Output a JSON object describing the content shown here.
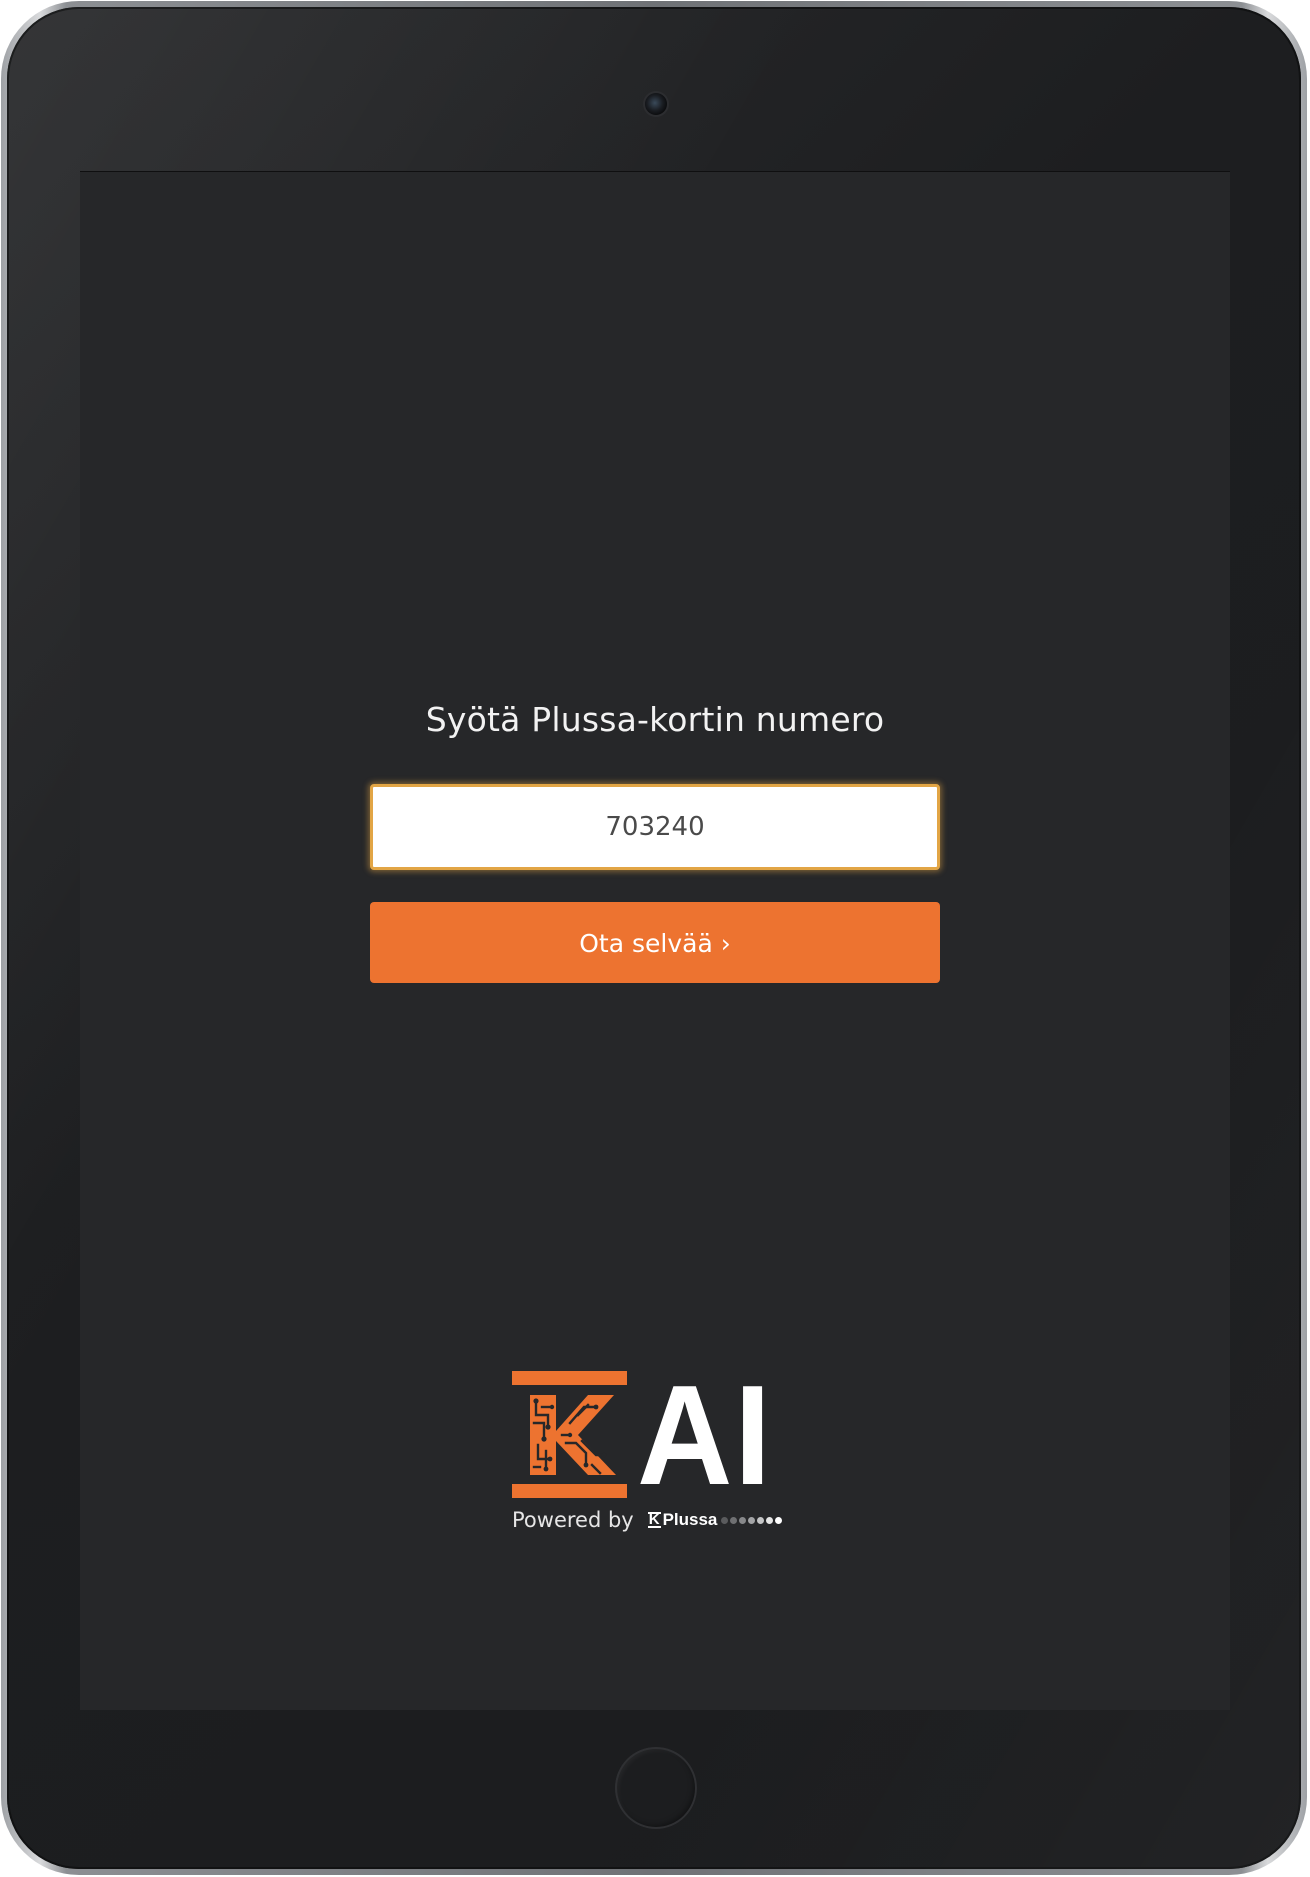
{
  "form": {
    "prompt": "Syötä Plussa-kortin numero",
    "card_number_value": "703240",
    "submit_label": "Ota selvää ›"
  },
  "branding": {
    "logo_text": "AI",
    "powered_by": "Powered by",
    "partner_name": "Plussa",
    "partner_mark": "K"
  },
  "icons": {
    "logo": "k-logo-icon",
    "camera": "camera-icon",
    "home": "home-button-icon"
  },
  "colors": {
    "accent": "#ed7330",
    "screen_background": "#262729",
    "input_focus_border": "#e2a545",
    "text": "#f2f2f2"
  }
}
